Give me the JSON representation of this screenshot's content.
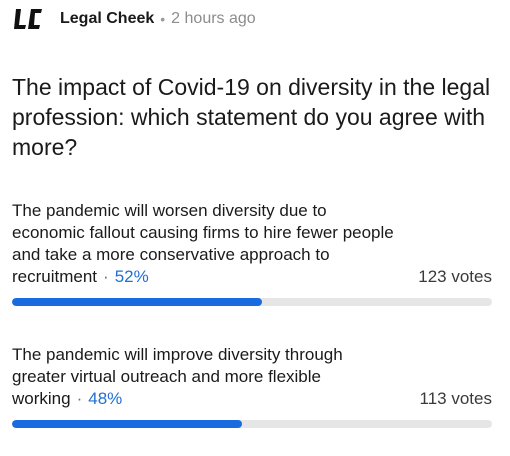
{
  "post": {
    "source": "Legal Cheek",
    "separator": "•",
    "timestamp": "2 hours ago"
  },
  "poll": {
    "question": "The impact of Covid-19 on diversity in the legal profession: which statement do you agree with more?",
    "options": [
      {
        "text": "The pandemic will worsen diversity due to economic fallout causing firms to hire fewer people and take a more conservative approach to recruitment",
        "separator": "·",
        "percent_label": "52%",
        "percent": 52,
        "votes": "123 votes"
      },
      {
        "text": "The pandemic will improve diversity through greater virtual outreach and more flexible working",
        "separator": "·",
        "percent_label": "48%",
        "percent": 48,
        "votes": "113 votes"
      }
    ]
  },
  "colors": {
    "accent": "#1a6ae0",
    "track": "#e6e6e6"
  },
  "icons": {
    "logo": "legal-cheek-logo"
  }
}
